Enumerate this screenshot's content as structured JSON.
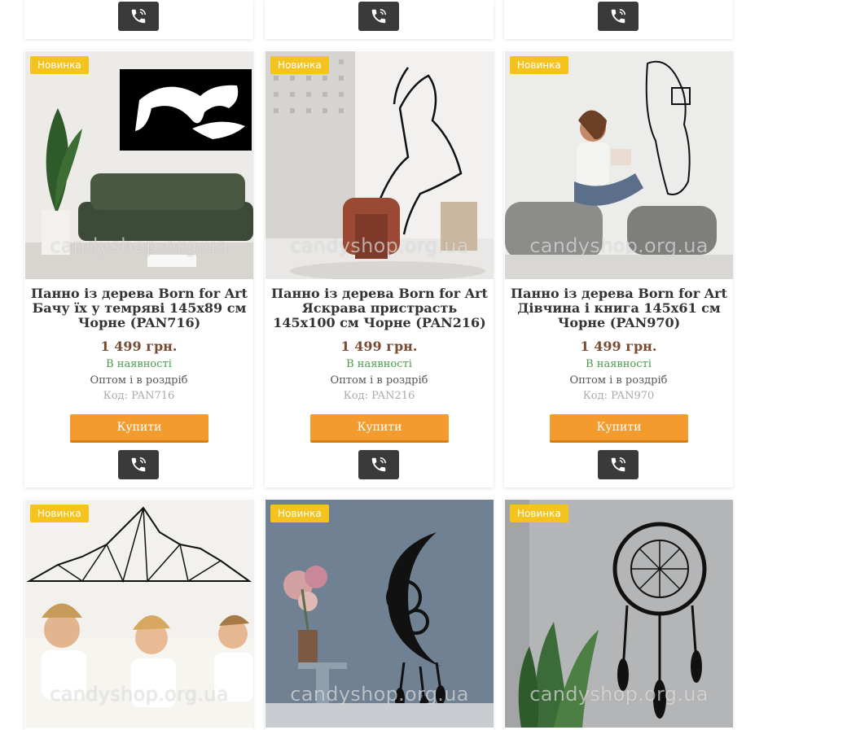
{
  "badge": "Новинка",
  "watermark": "candyshop.org.ua",
  "products": [
    {
      "title": "Панно із дерева Born for Art Бачу їх у темряві 145x89 см Чорне (PAN716)",
      "price": "1 499 грн.",
      "stock": "В наявності",
      "wholesale": "Оптом і в роздріб",
      "code": "Код: PAN716",
      "buy": "Купити"
    },
    {
      "title": "Панно із дерева Born for Art Яскрава пристрасть 145x100 см Чорне (PAN216)",
      "price": "1 499 грн.",
      "stock": "В наявності",
      "wholesale": "Оптом і в роздріб",
      "code": "Код: PAN216",
      "buy": "Купити"
    },
    {
      "title": "Панно із дерева Born for Art Дівчина і книга 145x61 см Чорне (PAN970)",
      "price": "1 499 грн.",
      "stock": "В наявності",
      "wholesale": "Оптом і в роздріб",
      "code": "Код: PAN970",
      "buy": "Купити"
    }
  ],
  "colors": {
    "badge": "#f4c31d",
    "buy_button": "#f39b2d",
    "phone_button": "#3a3a3a",
    "in_stock": "#4b9a4b",
    "price": "#7a4a30"
  }
}
